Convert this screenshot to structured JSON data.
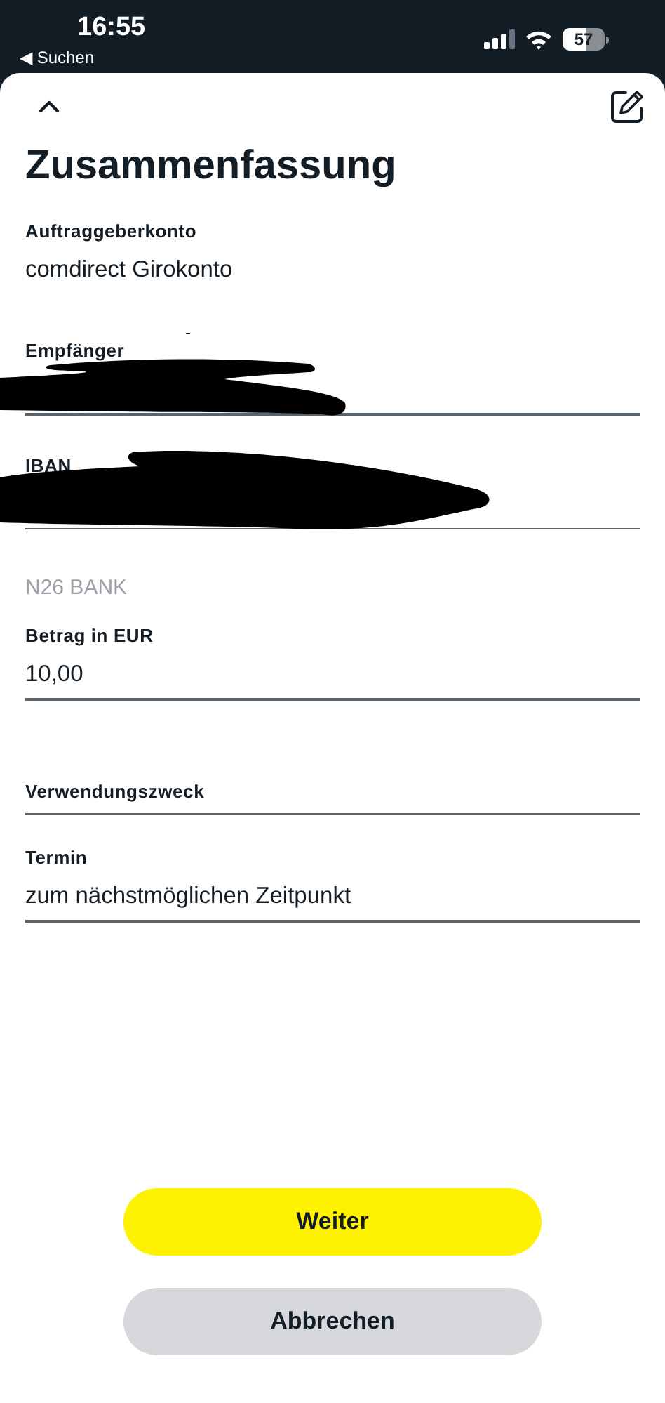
{
  "status_bar": {
    "time": "16:55",
    "back_link": "◀ Suchen",
    "battery": "57"
  },
  "title": "Zusammenfassung",
  "fields": [
    {
      "label": "Auftraggeberkonto",
      "value": "comdirect Girokonto",
      "underline": false,
      "redacted": false
    },
    {
      "label": "Empfänger",
      "underline": true,
      "redacted": true
    },
    {
      "label": "IBAN",
      "underline": true,
      "redacted": true,
      "note": "N26 BANK"
    },
    {
      "label": "Betrag in EUR",
      "value": "10,00",
      "underline": true,
      "redacted": false
    },
    {
      "label": "Verwendungszweck",
      "underline": true,
      "redacted": false
    },
    {
      "label": "Termin",
      "value": "zum nächstmöglichen Zeitpunkt",
      "underline": true,
      "redacted": false
    }
  ],
  "buttons": [
    {
      "label": "Weiter",
      "kind": "primary"
    },
    {
      "label": "Abbrechen",
      "kind": "secondary"
    }
  ]
}
